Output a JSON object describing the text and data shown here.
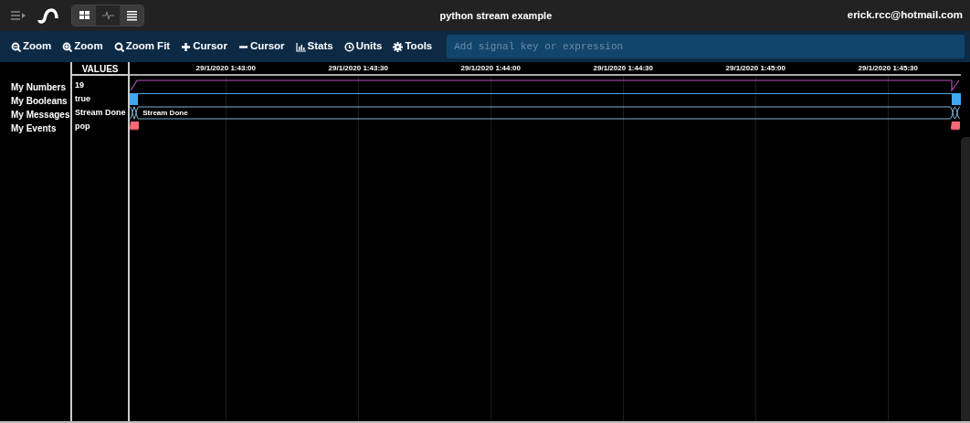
{
  "app_bar": {
    "view_modes": [
      {
        "kind": "grid",
        "selected": false
      },
      {
        "kind": "wave",
        "selected": true
      },
      {
        "kind": "list",
        "selected": false
      }
    ],
    "title": "python stream example",
    "user": "erick.rcc@hotmail.com"
  },
  "toolbar": [
    {
      "kind": "zoomout",
      "label": "Zoom"
    },
    {
      "kind": "zoomin",
      "label": "Zoom"
    },
    {
      "kind": "fit",
      "label": "Zoom Fit"
    },
    {
      "kind": "add",
      "label": "Cursor"
    },
    {
      "kind": "remove",
      "label": "Cursor"
    },
    {
      "kind": "stats",
      "label": "Stats"
    },
    {
      "kind": "units",
      "label": "Units"
    },
    {
      "kind": "tools",
      "label": "Tools"
    }
  ],
  "signal_search": {
    "placeholder": "Add signal key or expression"
  },
  "values_header": "VALUES",
  "time_axis": [
    "29/1/2020 1:43:00",
    "29/1/2020 1:43:30",
    "29/1/2020 1:44:00",
    "29/1/2020 1:44:30",
    "29/1/2020 1:45:00",
    "29/1/2020 1:45:30"
  ],
  "signals": [
    {
      "name": "My Numbers",
      "value": "19",
      "kind": "number"
    },
    {
      "name": "My Booleans",
      "value": "true",
      "kind": "boolean"
    },
    {
      "name": "My Messages",
      "value": "Stream Done",
      "kind": "message",
      "trace_label": "Stream Done"
    },
    {
      "name": "My Events",
      "value": "pop",
      "kind": "event"
    }
  ]
}
